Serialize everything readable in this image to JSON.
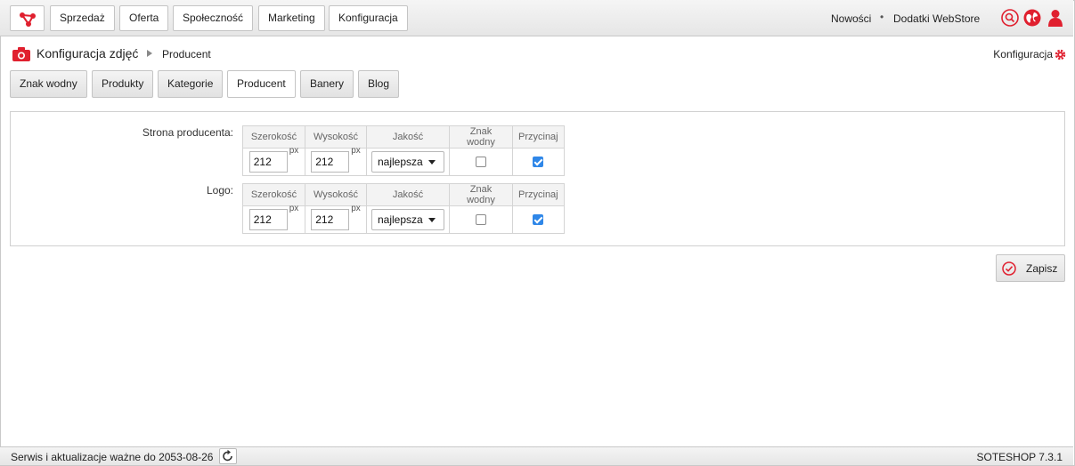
{
  "topbar": {
    "nav": [
      "Sprzedaż",
      "Oferta",
      "Społeczność",
      "Marketing",
      "Konfiguracja"
    ],
    "links": [
      "Nowości",
      "Dodatki WebStore"
    ],
    "separator": "•",
    "icons": [
      "search-icon",
      "globe-icon",
      "user-icon"
    ],
    "accent": "#e0202f"
  },
  "breadcrumb": {
    "title": "Konfiguracja zdjęć",
    "current": "Producent",
    "right_link": "Konfiguracja"
  },
  "tabs": [
    "Znak wodny",
    "Produkty",
    "Kategorie",
    "Producent",
    "Banery",
    "Blog"
  ],
  "active_tab": "Producent",
  "columns": [
    "Szerokość",
    "Wysokość",
    "Jakość",
    "Znak wodny",
    "Przycinaj"
  ],
  "rows": [
    {
      "label": "Strona producenta:",
      "width": "212",
      "height": "212",
      "unit": "px",
      "quality": "najlepsza",
      "watermark": false,
      "crop": true
    },
    {
      "label": "Logo:",
      "width": "212",
      "height": "212",
      "unit": "px",
      "quality": "najlepsza",
      "watermark": false,
      "crop": true
    }
  ],
  "save_label": "Zapisz",
  "footer": {
    "left": "Serwis i aktualizacje ważne do 2053-08-26",
    "right": "SOTESHOP 7.3.1"
  }
}
